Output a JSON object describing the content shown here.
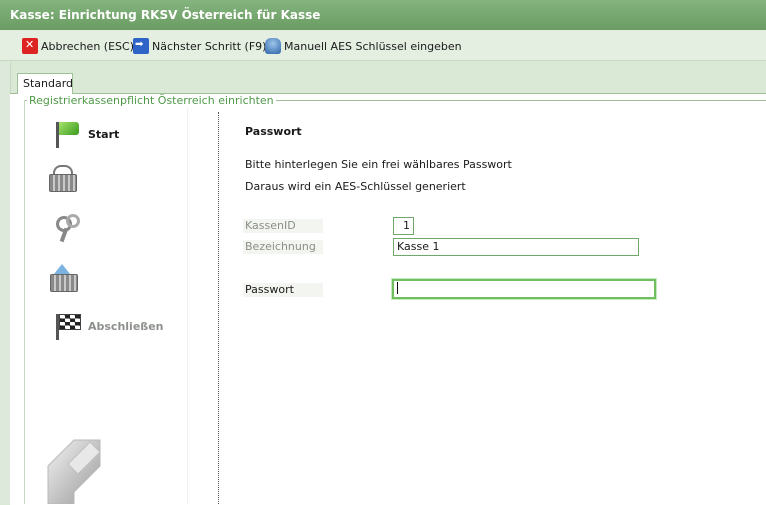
{
  "window": {
    "title": "Kasse: Einrichtung RKSV Österreich für Kasse"
  },
  "toolbar": {
    "abort_label": "Abbrechen (ESC)",
    "next_label": "Nächster Schritt (F9)",
    "manual_label": "Manuell AES Schlüssel eingeben"
  },
  "tabs": [
    {
      "label": "Standard",
      "active": true
    }
  ],
  "group": {
    "label": "Registrierkassenpflicht Österreich einrichten"
  },
  "steps": [
    {
      "icon": "green-flag-icon",
      "label": "Start",
      "active": true
    },
    {
      "icon": "cash-register-icon",
      "label": ""
    },
    {
      "icon": "keys-icon",
      "label": ""
    },
    {
      "icon": "basket-arrow-icon",
      "label": ""
    },
    {
      "icon": "checkered-flag-icon",
      "label": "Abschließen",
      "active": false
    }
  ],
  "form": {
    "heading": "Passwort",
    "line1": "Bitte hinterlegen Sie ein frei wählbares Passwort",
    "line2": "Daraus wird ein AES-Schlüssel generiert",
    "kassen_id_label": "KassenID",
    "kassen_id_value": "1",
    "bezeichnung_label": "Bezeichnung",
    "bezeichnung_value": "Kasse 1",
    "passwort_label": "Passwort",
    "passwort_value": ""
  },
  "colors": {
    "title_bar": "#6fa268",
    "accent": "#4e9a47",
    "content_bg": "#ffffff"
  }
}
